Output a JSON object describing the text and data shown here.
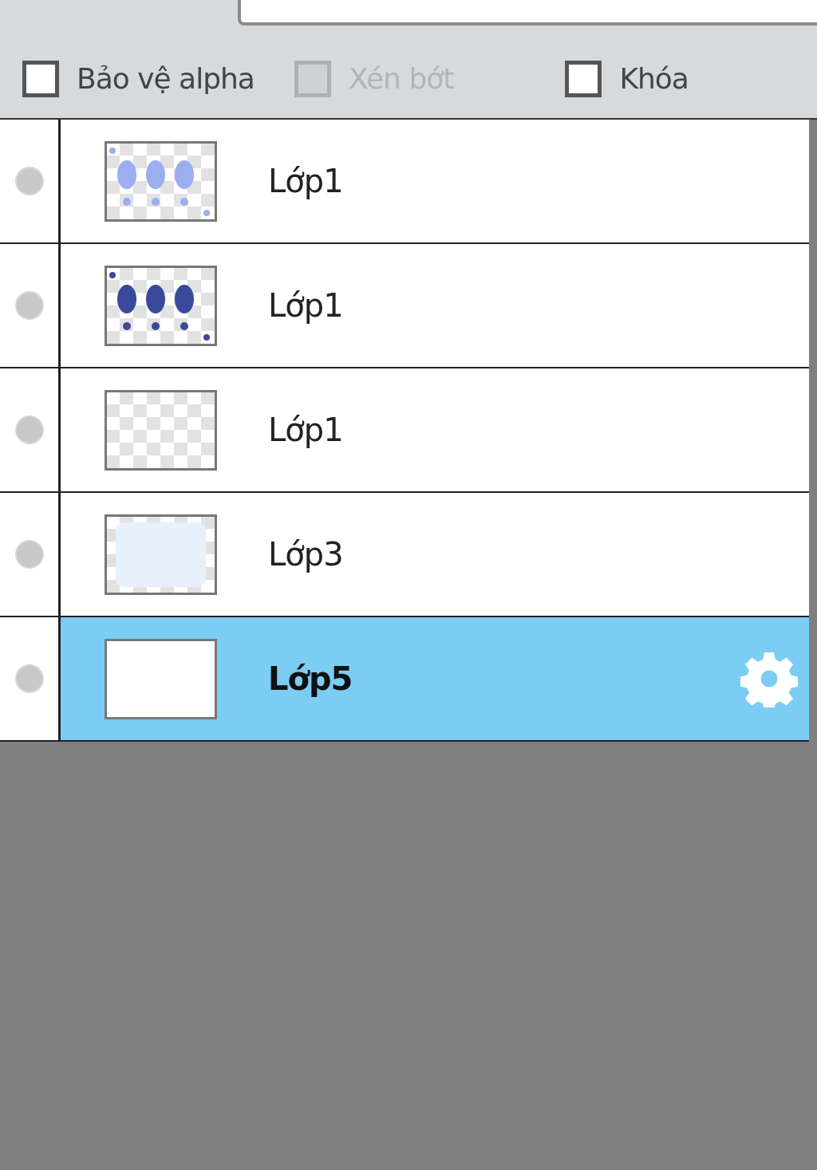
{
  "options": [
    {
      "label": "Bảo vệ alpha",
      "checked": false,
      "disabled": false
    },
    {
      "label": "Xén bớt",
      "checked": false,
      "disabled": true
    },
    {
      "label": "Khóa",
      "checked": false,
      "disabled": false
    }
  ],
  "layers": [
    {
      "name": "Lớp1",
      "selected": false,
      "thumbnail": {
        "kind": "marks_light"
      }
    },
    {
      "name": "Lớp1",
      "selected": false,
      "thumbnail": {
        "kind": "marks_dark"
      }
    },
    {
      "name": "Lớp1",
      "selected": false,
      "thumbnail": {
        "kind": "empty"
      }
    },
    {
      "name": "Lớp3",
      "selected": false,
      "thumbnail": {
        "kind": "tint"
      }
    },
    {
      "name": "Lớp5",
      "selected": true,
      "thumbnail": {
        "kind": "white"
      }
    }
  ]
}
